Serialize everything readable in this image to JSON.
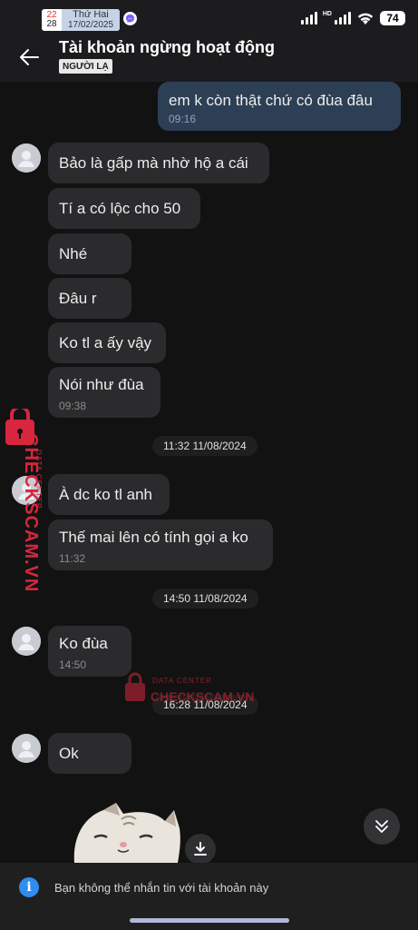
{
  "status_bar": {
    "calendar_top": "22",
    "calendar_bottom": "28",
    "weekday": "Thứ Hai",
    "date": "17/02/2025",
    "battery": "74",
    "network_label": "HD"
  },
  "header": {
    "title": "Tài khoản ngừng hoạt động",
    "tag": "NGƯỜI LẠ"
  },
  "messages": [
    {
      "text": "em k còn thật chứ có đùa đâu",
      "time": "09:16"
    },
    {
      "text": "Bảo là gấp mà nhờ hộ a cái"
    },
    {
      "text": "Tí a có lộc cho 50"
    },
    {
      "text": "Nhé"
    },
    {
      "text": "Đâu r"
    },
    {
      "text": "Ko tl a ấy vậy"
    },
    {
      "text": "Nói như đùa",
      "time": "09:38"
    },
    {
      "text": "À dc ko tl anh"
    },
    {
      "text": "Thế mai lên có tính gọi a ko",
      "time": "11:32"
    },
    {
      "text": "Ko đùa",
      "time": "14:50"
    },
    {
      "text": "Ok"
    }
  ],
  "separators": [
    "11:32 11/08/2024",
    "14:50 11/08/2024",
    "16:28 11/08/2024"
  ],
  "watermark": {
    "top_text": "DATA CENTER",
    "main_text": "CHECKSCAM.VN",
    "color": "#d7263d"
  },
  "footer": {
    "notice": "Bạn không thể nhắn tin với tài khoản này"
  },
  "colors": {
    "background": "#121212",
    "bubble_incoming": "#2b2b2d",
    "bubble_outgoing": "#2c3f55",
    "info_blue": "#2f8cf0"
  }
}
